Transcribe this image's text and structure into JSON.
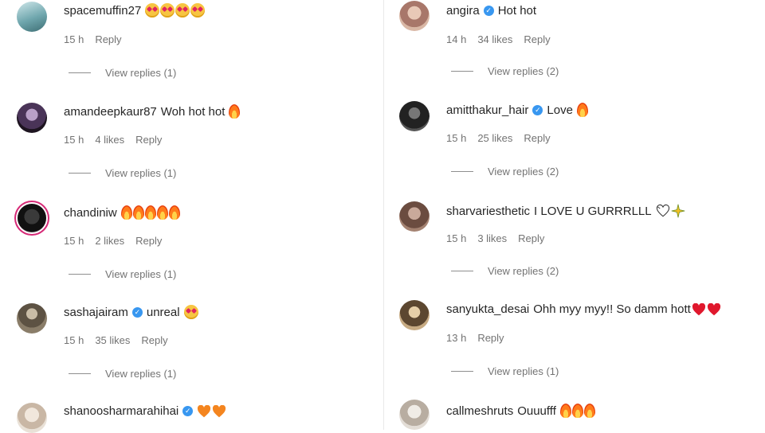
{
  "left_column": [
    {
      "username": "spacemuffin27",
      "verified": false,
      "text": "",
      "emoji": [
        "heart-eyes",
        "heart-eyes",
        "heart-eyes",
        "heart-eyes"
      ],
      "time": "15 h",
      "likes": "",
      "reply": "Reply",
      "view_replies": "View replies (1)"
    },
    {
      "username": "amandeepkaur87",
      "verified": false,
      "text": "Woh hot hot",
      "emoji": [
        "fire"
      ],
      "time": "15 h",
      "likes": "4 likes",
      "reply": "Reply",
      "view_replies": "View replies (1)"
    },
    {
      "username": "chandiniw",
      "verified": false,
      "text": "",
      "emoji": [
        "fire",
        "fire",
        "fire",
        "fire",
        "fire"
      ],
      "time": "15 h",
      "likes": "2 likes",
      "reply": "Reply",
      "view_replies": "View replies (1)"
    },
    {
      "username": "sashajairam",
      "verified": true,
      "text": "unreal",
      "emoji": [
        "heart-eyes"
      ],
      "time": "15 h",
      "likes": "35 likes",
      "reply": "Reply",
      "view_replies": "View replies (1)"
    },
    {
      "username": "shanoosharmarahihai",
      "verified": true,
      "text": "",
      "emoji": [
        "orange-heart",
        "orange-heart"
      ],
      "time": "",
      "likes": "",
      "reply": "",
      "view_replies": ""
    }
  ],
  "right_column": [
    {
      "username": "angira",
      "verified": true,
      "text": "Hot hot",
      "emoji": [],
      "time": "14 h",
      "likes": "34 likes",
      "reply": "Reply",
      "view_replies": "View replies (2)"
    },
    {
      "username": "amitthakur_hair",
      "verified": true,
      "text": "Love",
      "emoji": [
        "fire"
      ],
      "time": "15 h",
      "likes": "25 likes",
      "reply": "Reply",
      "view_replies": "View replies (2)"
    },
    {
      "username": "sharvariesthetic",
      "verified": false,
      "text": "I LOVE U GURRRLLL",
      "emoji": [
        "white-heart-dove",
        "sparkle"
      ],
      "time": "15 h",
      "likes": "3 likes",
      "reply": "Reply",
      "view_replies": "View replies (2)"
    },
    {
      "username": "sanyukta_desai",
      "verified": false,
      "text": "Ohh myy myy!! So damm hott",
      "emoji": [
        "red-heart",
        "red-heart"
      ],
      "time": "13 h",
      "likes": "",
      "reply": "Reply",
      "view_replies": "View replies (1)"
    },
    {
      "username": "callmeshruts",
      "verified": false,
      "text": "Ouuufff",
      "emoji": [
        "fire",
        "fire",
        "fire"
      ],
      "time": "",
      "likes": "",
      "reply": "",
      "view_replies": ""
    }
  ],
  "colors": {
    "text": "#262626",
    "meta": "#737373",
    "verified": "#3897f0",
    "story_ring": "#d62976"
  }
}
